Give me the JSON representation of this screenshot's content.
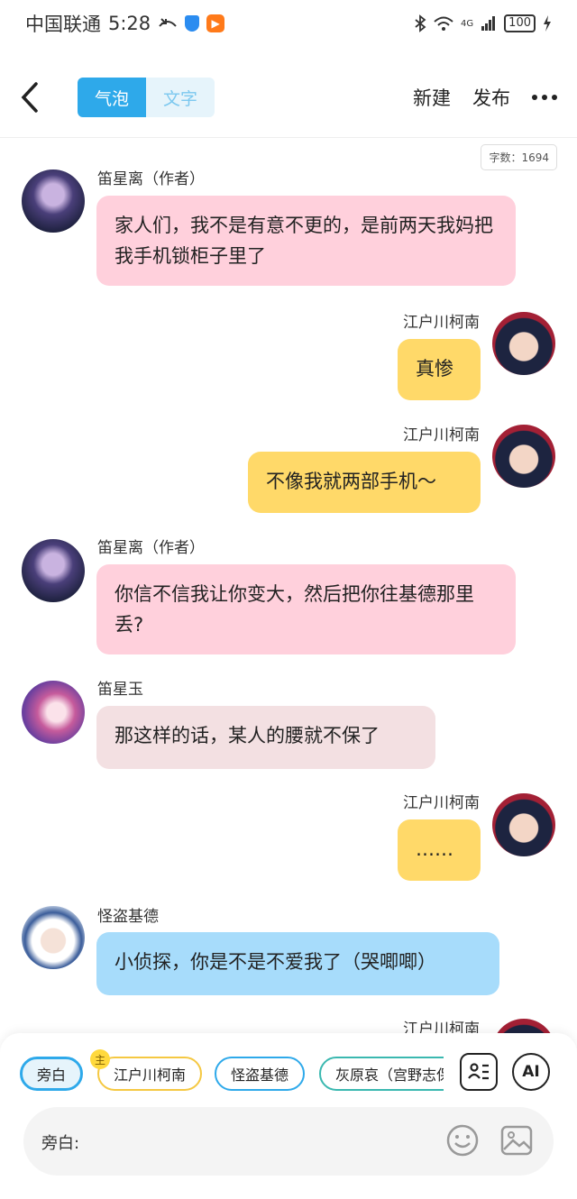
{
  "status": {
    "carrier": "中国联通",
    "time": "5:28",
    "app_badge": "▶",
    "signal": "4G",
    "battery": "100"
  },
  "header": {
    "tab_bubble": "气泡",
    "tab_text": "文字",
    "new_label": "新建",
    "publish_label": "发布"
  },
  "word_count": "字数：1694",
  "messages": [
    {
      "name": "笛星离（作者）",
      "text": "家人们，我不是有意不更的，是前两天我妈把我手机锁柜子里了"
    },
    {
      "name": "江户川柯南",
      "text": "真惨"
    },
    {
      "name": "江户川柯南",
      "text": "不像我就两部手机～"
    },
    {
      "name": "笛星离（作者）",
      "text": "你信不信我让你变大，然后把你往基德那里丢?"
    },
    {
      "name": "笛星玉",
      "text": "那这样的话，某人的腰就不保了"
    },
    {
      "name": "江户川柯南",
      "text": "……"
    },
    {
      "name": "怪盗基德",
      "text": "小侦探，你是不是不爱我了（哭唧唧）"
    },
    {
      "name": "江户川柯南",
      "text": ""
    }
  ],
  "roles": [
    {
      "label": "旁白",
      "color": "#2ea9ea"
    },
    {
      "label": "江户川柯南",
      "color": "#f5c842"
    },
    {
      "label": "怪盗基德",
      "color": "#2ea9ea"
    },
    {
      "label": "灰原哀（宫野志保）",
      "color": "#3ab8b0"
    }
  ],
  "main_badge": "主",
  "ai_label": "AI",
  "input": {
    "label": "旁白:"
  }
}
